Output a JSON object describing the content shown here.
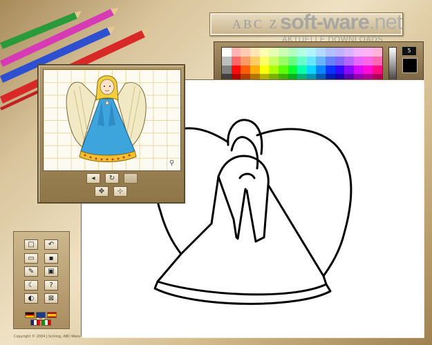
{
  "app": {
    "title": "ABC Z",
    "copyright": "Copyright © 2004 J.Schling, ABC-Ware"
  },
  "watermark": {
    "brand": "soft",
    "brand_mid": "ware",
    "brand_tld": ".net",
    "tagline": "AKTUELLE DOWNLOADS"
  },
  "palette": {
    "brush_size": "5",
    "current_color": "#000000",
    "close_label": "×"
  },
  "preview": {
    "buttons": [
      "back",
      "undo",
      "blank",
      "fill",
      "picker"
    ]
  },
  "tools": {
    "items": [
      {
        "name": "new-page-button",
        "icon": "square-icon",
        "glyph": "□"
      },
      {
        "name": "undo-button",
        "icon": "undo-arrow-icon",
        "glyph": "↶"
      },
      {
        "name": "open-button",
        "icon": "folder-icon",
        "glyph": "▭"
      },
      {
        "name": "save-button",
        "icon": "disk-icon",
        "glyph": "▪"
      },
      {
        "name": "pencil-button",
        "icon": "pencil-icon",
        "glyph": "✎"
      },
      {
        "name": "picture-button",
        "icon": "picture-icon",
        "glyph": "▣"
      },
      {
        "name": "moon-button",
        "icon": "moon-icon",
        "glyph": "☾"
      },
      {
        "name": "help-button",
        "icon": "question-icon",
        "glyph": "?"
      },
      {
        "name": "color-button",
        "icon": "color-wheel-icon",
        "glyph": "◐"
      },
      {
        "name": "exit-button",
        "icon": "close-icon",
        "glyph": "⊠"
      }
    ]
  },
  "colors": {
    "panel": "#b59d71",
    "canvas": "#ffffff",
    "ink": "#000000"
  }
}
